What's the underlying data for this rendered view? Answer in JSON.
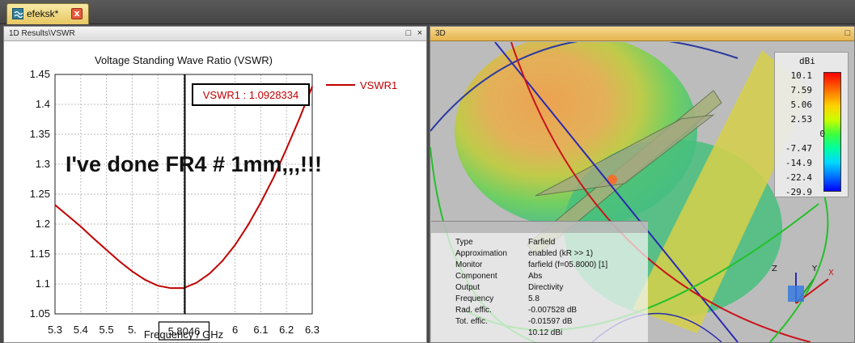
{
  "tab": {
    "title": "efeksk*",
    "close_glyph": "x"
  },
  "left_panel": {
    "header": "1D Results\\VSWR",
    "restore_glyph": "□",
    "close_glyph": "×"
  },
  "right_panel": {
    "header": "3D",
    "restore_glyph": "□"
  },
  "overlay_text": "I've done FR4 # 1mm,,,!!!",
  "chart_data": {
    "type": "line",
    "title": "Voltage Standing Wave Ratio (VSWR)",
    "xlabel": "Frequency / GHz",
    "ylabel": "",
    "xlim": [
      5.3,
      6.3
    ],
    "ylim": [
      1.05,
      1.45
    ],
    "xticks": [
      "5.3",
      "5.4",
      "5.5",
      "5.",
      "5.8046",
      ".9",
      "6",
      "6.1",
      "6.2",
      "6.3"
    ],
    "xtick_values": [
      5.3,
      5.4,
      5.5,
      5.6,
      5.7,
      5.8,
      6.0,
      6.1,
      6.2,
      6.3
    ],
    "yticks": [
      "1.05",
      "1.1",
      "1.15",
      "1.2",
      "1.25",
      "1.3",
      "1.35",
      "1.4",
      "1.45"
    ],
    "ytick_values": [
      1.05,
      1.1,
      1.15,
      1.2,
      1.25,
      1.3,
      1.35,
      1.4,
      1.45
    ],
    "grid": true,
    "legend": "top-right",
    "marker": {
      "x": 5.8046,
      "label": "VSWR1 : 1.0928334"
    },
    "series": [
      {
        "name": "VSWR1",
        "color": "#c00000",
        "x": [
          5.3,
          5.35,
          5.4,
          5.45,
          5.5,
          5.55,
          5.6,
          5.65,
          5.7,
          5.75,
          5.8,
          5.85,
          5.9,
          5.95,
          6.0,
          6.05,
          6.1,
          6.15,
          6.2,
          6.25,
          6.3
        ],
        "y": [
          1.232,
          1.214,
          1.196,
          1.176,
          1.157,
          1.138,
          1.121,
          1.107,
          1.097,
          1.093,
          1.093,
          1.102,
          1.117,
          1.138,
          1.165,
          1.198,
          1.236,
          1.278,
          1.326,
          1.376,
          1.43
        ]
      }
    ]
  },
  "legend_3d": {
    "unit": "dBi",
    "ticks": [
      "10.1",
      "7.59",
      "5.06",
      "2.53",
      "0",
      "-7.47",
      "-14.9",
      "-22.4",
      "-29.9"
    ]
  },
  "info_box": {
    "rows": [
      {
        "k": "Type",
        "v": "Farfield"
      },
      {
        "k": "Approximation",
        "v": "enabled (kR >> 1)"
      },
      {
        "k": "Monitor",
        "v": "farfield (f=05.8000) [1]"
      },
      {
        "k": "Component",
        "v": "Abs"
      },
      {
        "k": "Output",
        "v": "Directivity"
      },
      {
        "k": "Frequency",
        "v": "5.8"
      },
      {
        "k": "Rad. effic.",
        "v": "-0.007528 dB"
      },
      {
        "k": "Tot. effic.",
        "v": "-0.01597 dB"
      },
      {
        "k": "",
        "v": "10.12 dBi"
      }
    ]
  },
  "triad": {
    "z": "Z",
    "y": "Y",
    "x": "X"
  },
  "colors": {
    "accent": "#e6b54e",
    "curve": "#c00000",
    "marker_box": "#c00000"
  }
}
